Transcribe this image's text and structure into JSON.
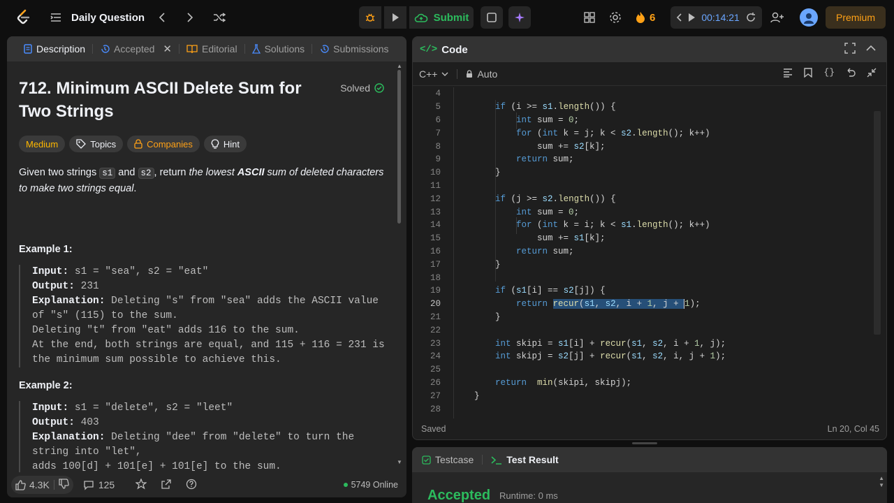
{
  "topbar": {
    "title": "Daily Question",
    "submit_label": "Submit",
    "streak": "6",
    "timer": "00:14:21",
    "premium": "Premium"
  },
  "left": {
    "tabs": [
      {
        "label": "Description"
      },
      {
        "label": "Accepted"
      },
      {
        "label": "Editorial"
      },
      {
        "label": "Solutions"
      },
      {
        "label": "Submissions"
      }
    ],
    "title": "712. Minimum ASCII Delete Sum for Two Strings",
    "solved": "Solved",
    "chips": {
      "difficulty": "Medium",
      "topics": "Topics",
      "companies": "Companies",
      "hint": "Hint"
    },
    "desc": {
      "p1": "Given two strings ",
      "s1": "s1",
      "and": " and ",
      "s2": "s2",
      "p2": ", return ",
      "i1": "the lowest ",
      "bi": "ASCII",
      "i2": " sum of deleted characters to make two strings equal",
      "end": "."
    },
    "example1": {
      "title": "Example 1:",
      "input_label": "Input:",
      "input": " s1 = \"sea\", s2 = \"eat\"",
      "output_label": "Output:",
      "output": " 231",
      "expl_label": "Explanation:",
      "expl": " Deleting \"s\" from \"sea\" adds the ASCII value of \"s\" (115) to the sum.",
      "line2": "Deleting \"t\" from \"eat\" adds 116 to the sum.",
      "line3": "At the end, both strings are equal, and 115 + 116 = 231 is the minimum sum possible to achieve this."
    },
    "example2": {
      "title": "Example 2:",
      "input_label": "Input:",
      "input": " s1 = \"delete\", s2 = \"leet\"",
      "output_label": "Output:",
      "output": " 403",
      "expl_label": "Explanation:",
      "expl": " Deleting \"dee\" from \"delete\" to turn the string into \"let\",",
      "line2": "adds 100[d] + 101[e] + 101[e] to the sum."
    },
    "footer": {
      "likes": "4.3K",
      "comments": "125",
      "online": "5749 Online"
    }
  },
  "right": {
    "title": "Code",
    "language": "C++",
    "mode": "Auto",
    "status_left": "Saved",
    "status_right": "Ln 20, Col 45",
    "code_lines": [
      {
        "n": "4"
      },
      {
        "n": "5"
      },
      {
        "n": "6"
      },
      {
        "n": "7"
      },
      {
        "n": "8"
      },
      {
        "n": "9"
      },
      {
        "n": "10"
      },
      {
        "n": "11"
      },
      {
        "n": "12"
      },
      {
        "n": "13"
      },
      {
        "n": "14"
      },
      {
        "n": "15"
      },
      {
        "n": "16"
      },
      {
        "n": "17"
      },
      {
        "n": "18"
      },
      {
        "n": "19"
      },
      {
        "n": "20"
      },
      {
        "n": "21"
      },
      {
        "n": "22"
      },
      {
        "n": "23"
      },
      {
        "n": "24"
      },
      {
        "n": "25"
      },
      {
        "n": "26"
      },
      {
        "n": "27"
      },
      {
        "n": "28"
      }
    ]
  },
  "bottom": {
    "testcase": "Testcase",
    "result": "Test Result",
    "accepted": "Accepted",
    "runtime": "Runtime: 0 ms"
  }
}
